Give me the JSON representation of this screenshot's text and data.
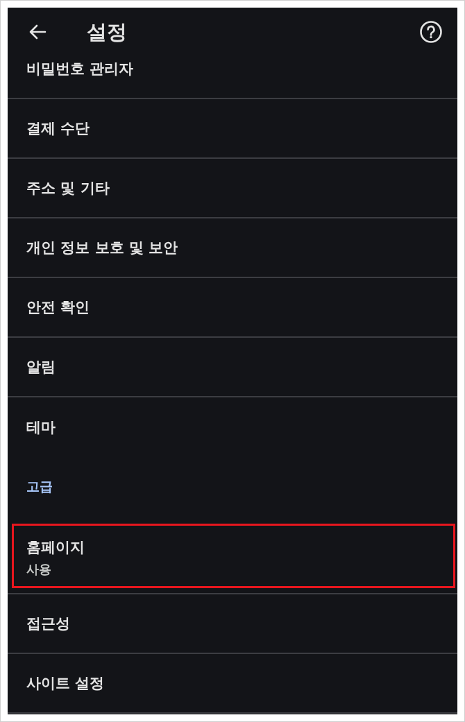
{
  "header": {
    "title": "설정"
  },
  "items": [
    {
      "kind": "item",
      "title": "비밀번호 관리자",
      "highlighted": false
    },
    {
      "kind": "item",
      "title": "결제 수단",
      "highlighted": false
    },
    {
      "kind": "item",
      "title": "주소 및 기타",
      "highlighted": false
    },
    {
      "kind": "item",
      "title": "개인 정보 보호 및 보안",
      "highlighted": false
    },
    {
      "kind": "item",
      "title": "안전 확인",
      "highlighted": false
    },
    {
      "kind": "item",
      "title": "알림",
      "highlighted": false
    },
    {
      "kind": "item",
      "title": "테마",
      "highlighted": false
    },
    {
      "kind": "section",
      "title": "고급",
      "highlighted": false
    },
    {
      "kind": "item",
      "title": "홈페이지",
      "subtitle": "사용",
      "highlighted": true
    },
    {
      "kind": "item",
      "title": "접근성",
      "highlighted": false
    },
    {
      "kind": "item",
      "title": "사이트 설정",
      "highlighted": false
    }
  ]
}
